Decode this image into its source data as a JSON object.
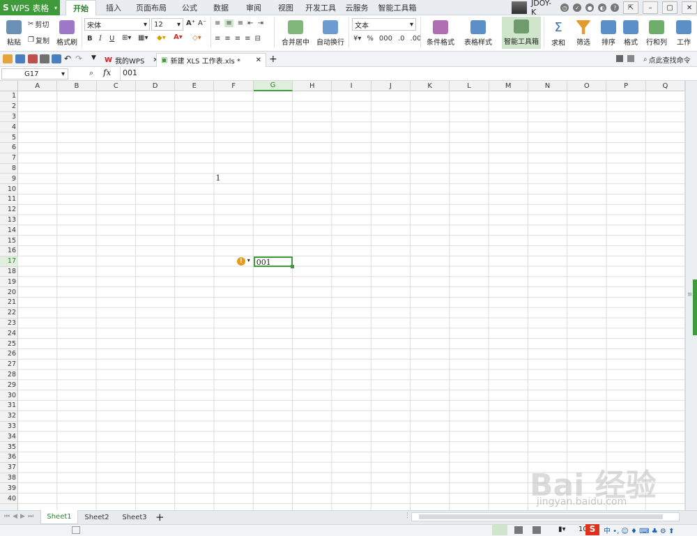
{
  "app": {
    "name": "WPS 表格"
  },
  "menu": {
    "tabs": [
      "开始",
      "插入",
      "页面布局",
      "公式",
      "数据",
      "审阅",
      "视图",
      "开发工具",
      "云服务",
      "智能工具箱"
    ],
    "active": 0
  },
  "user": {
    "name": "JDOY-K"
  },
  "ribbon": {
    "paste": "粘贴",
    "cut": "剪切",
    "copy": "复制",
    "format_painter": "格式刷",
    "font_name": "宋体",
    "font_size": "12",
    "bold": "B",
    "italic": "I",
    "underline": "U",
    "merge_center": "合并居中",
    "wrap_text": "自动换行",
    "number_format": "文本",
    "percent": "%",
    "conditional_format": "条件格式",
    "table_style": "表格样式",
    "smart_toolbox": "智能工具箱",
    "sum": "求和",
    "filter": "筛选",
    "sort": "排序",
    "format": "格式",
    "rows_cols": "行和列",
    "worksheet": "工作"
  },
  "doc_tabs": [
    {
      "label": "我的WPS"
    },
    {
      "label": "新建 XLS 工作表.xls *"
    }
  ],
  "search_cmd": "点此查找命令",
  "formula_bar": {
    "name_box": "G17",
    "fx": "fx",
    "value": "001"
  },
  "columns": [
    "A",
    "B",
    "C",
    "D",
    "E",
    "F",
    "G",
    "H",
    "I",
    "J",
    "K",
    "L",
    "M",
    "N",
    "O",
    "P",
    "Q"
  ],
  "selected_col": "G",
  "rows": [
    "1",
    "2",
    "3",
    "4",
    "5",
    "6",
    "7",
    "8",
    "9",
    "10",
    "11",
    "12",
    "13",
    "14",
    "15",
    "16",
    "17",
    "18",
    "19",
    "20",
    "21",
    "22",
    "23",
    "24",
    "25",
    "26",
    "27",
    "28",
    "29",
    "30",
    "31",
    "32",
    "33",
    "34",
    "35",
    "36",
    "37",
    "38",
    "39",
    "40"
  ],
  "selected_row": "17",
  "cells": {
    "F9": "1",
    "G17": "001"
  },
  "sheets": [
    "Sheet1",
    "Sheet2",
    "Sheet3"
  ],
  "active_sheet": 0,
  "status": {
    "zoom": "10"
  },
  "watermark": {
    "brand": "Bai 经验",
    "url": "jingyan.baidu.com"
  },
  "colors": {
    "accent": "#3f9a3a",
    "selection": "#dfeedd"
  }
}
